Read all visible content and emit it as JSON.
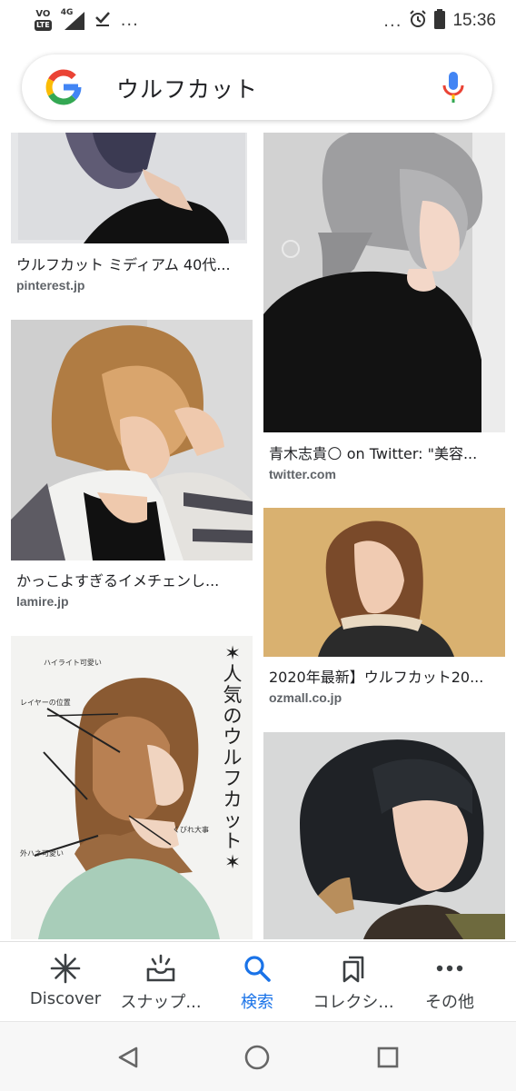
{
  "status_bar": {
    "volte_label": "VO",
    "lte_label": "LTE",
    "network_label": "4G",
    "left_overflow": "...",
    "right_overflow": "...",
    "time": "15:36"
  },
  "search": {
    "query": "ウルフカット",
    "logo_letter": "G"
  },
  "results": [
    {
      "caption": "ウルフカット ミディアム 40代...",
      "source": "pinterest.jp"
    },
    {
      "caption": "青木志貴🌕 on Twitter: \"美容...",
      "source": "twitter.com"
    },
    {
      "caption": "かっこよすぎるイメチェンし...",
      "source": "lamire.jp"
    },
    {
      "caption": "2020年最新】ウルフカット20...",
      "source": "ozmall.co.jp"
    }
  ],
  "infographic": {
    "vertical_title": "✶人気のウルフカット✶",
    "notes": [
      "ハイライト可愛い",
      "レイヤーの位置",
      "くびれ大事",
      "外ハネ可愛い"
    ]
  },
  "bottom_nav": [
    {
      "label": "Discover",
      "icon": "discover-asterisk-icon",
      "active": false
    },
    {
      "label": "スナップ...",
      "icon": "snapshot-tray-icon",
      "active": false
    },
    {
      "label": "検索",
      "icon": "search-icon",
      "active": true
    },
    {
      "label": "コレクシ...",
      "icon": "bookmark-collections-icon",
      "active": false
    },
    {
      "label": "その他",
      "icon": "more-horizontal-icon",
      "active": false
    }
  ],
  "colors": {
    "accent": "#1a73e8",
    "google_blue": "#4285F4",
    "google_red": "#EA4335",
    "google_yellow": "#FBBC05",
    "google_green": "#34A853"
  }
}
